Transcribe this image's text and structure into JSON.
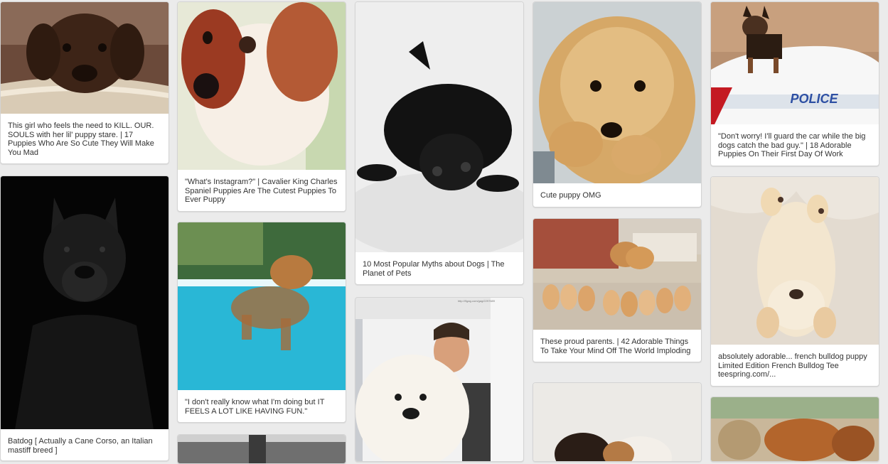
{
  "pins": [
    {
      "id": "p1",
      "caption": "This girl who feels the need to KILL. OUR. SOULS with her lil' puppy stare. | 17 Puppies Who Are So Cute They Will Make You Mad",
      "image": "chocolate lab puppy on cushion"
    },
    {
      "id": "p2",
      "caption": "Batdog [ Actually a Cane Corso, an Italian mastiff breed ]",
      "image": "black cane corso portrait"
    },
    {
      "id": "p3",
      "caption": "\"What's Instagram?\" | Cavalier King Charles Spaniel Puppies Are The Cutest Puppies To Ever Puppy",
      "image": "cavalier spaniel puppy"
    },
    {
      "id": "p4",
      "caption": "\"I don't really know what I'm doing but IT FEELS A LOT LIKE HAVING FUN.\"",
      "image": "puppy swimming in pool"
    },
    {
      "id": "p5",
      "caption": "",
      "image": "partial pin"
    },
    {
      "id": "p6",
      "caption": "10 Most Popular Myths about Dogs | The Planet of Pets",
      "image": "black pug lying down"
    },
    {
      "id": "p7",
      "caption": "",
      "image": "boy holding white samoyed",
      "watermark": "http://9gag.com/gag/2297689"
    },
    {
      "id": "p8",
      "caption": "Cute puppy OMG",
      "image": "golden retriever puppy paws"
    },
    {
      "id": "p9",
      "caption": "These proud parents. | 42 Adorable Things To Take Your Mind Off The World Imploding",
      "image": "golden retriever litter eating"
    },
    {
      "id": "p10",
      "caption": "",
      "image": "partial pin puppies"
    },
    {
      "id": "p11",
      "caption": "\"Don't worry! I'll guard the car while the big dogs catch the bad guy.\" | 18 Adorable Puppies On Their First Day Of Work",
      "image": "german shepherd puppy on police car",
      "car_text": "POLICE"
    },
    {
      "id": "p12",
      "caption": "absolutely adorable... french bulldog puppy Limited Edition French Bulldog Tee teespring.com/...",
      "image": "french bulldog puppy on back"
    },
    {
      "id": "p13",
      "caption": "",
      "image": "teddy bear and puppy"
    }
  ]
}
